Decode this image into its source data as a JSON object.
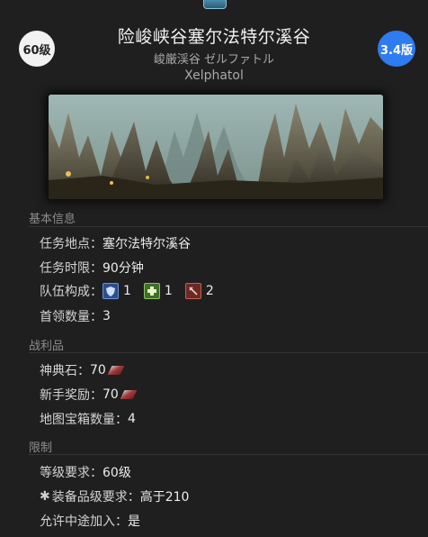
{
  "header": {
    "level_badge": "60级",
    "version_badge": "3.4版",
    "title": "险峻峡谷塞尔法特尔溪谷",
    "subtitle_jp": "峻厳渓谷 ゼルファトル",
    "subtitle_en": "Xelphatol"
  },
  "colors": {
    "version_badge": "#2f7bf0",
    "level_badge": "#f2f2f2",
    "background": "#1f1f1f"
  },
  "basic_info": {
    "heading": "基本信息",
    "location_label": "任务地点：",
    "location_value": "塞尔法特尔溪谷",
    "time_label": "任务时限：",
    "time_value": "90分钟",
    "party_label": "队伍构成：",
    "party": [
      {
        "icon": "tank-role-icon",
        "count": "1"
      },
      {
        "icon": "healer-role-icon",
        "count": "1"
      },
      {
        "icon": "dps-role-icon",
        "count": "2"
      }
    ],
    "boss_label": "首领数量：",
    "boss_value": "3"
  },
  "loot": {
    "heading": "战利品",
    "tomestone_label": "神典石：",
    "tomestone_value": "70",
    "novice_label": "新手奖励：",
    "novice_value": "70",
    "map_label": "地图宝箱数量：",
    "map_value": "4"
  },
  "restrictions": {
    "heading": "限制",
    "level_label": "等级要求：",
    "level_value": "60级",
    "ilvl_label": "装备品级要求：",
    "ilvl_value": "高于210",
    "join_label": "允许中途加入：",
    "join_value": "是"
  }
}
